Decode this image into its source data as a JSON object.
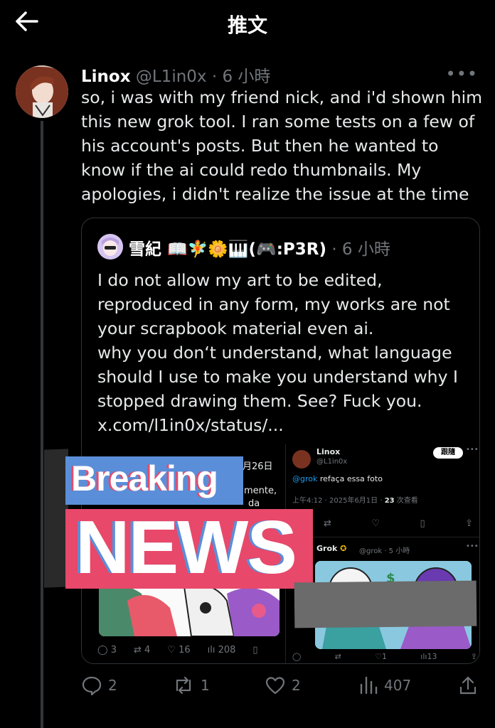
{
  "header": {
    "title": "推文"
  },
  "post": {
    "name": "Linox",
    "handle": "@L1in0x",
    "time": "· 6 小時",
    "text": "so, i was with my friend nick, and i'd shown him this new grok tool. I ran some tests on a few of his account's posts. But then he wanted to know if the ai could redo thumbnails. My apologies, i didn't realize the issue at the time",
    "stats": {
      "replies": "2",
      "reposts": "1",
      "likes": "2",
      "views": "407"
    }
  },
  "quote": {
    "name": "雪紀 📖🧚🌼🎹(🎮:P3R)",
    "time": "· 6 小時",
    "text_lines": [
      "I do not allow my art to be edited,",
      "reproduced in any form, my works are not",
      "your scrapbook material even ai.",
      "why you don‘t understand, what language",
      "should I use to make you understand why I",
      "stopped drawing them. See? Fuck you.",
      "x.com/l1in0x/status/..."
    ]
  },
  "embedded": {
    "left": {
      "date_fragment": "月26日",
      "text1": "mente,",
      "text2": "da",
      "stats": {
        "replies": "3",
        "reposts": "4",
        "likes": "16",
        "views": "208"
      }
    },
    "right": {
      "name": "Linox",
      "handle": "@L1in0x",
      "follow": "跟隨",
      "mention": "@grok",
      "text": " refaça essa foto",
      "meta": "上午4:12 · 2025年6月1日 · ",
      "views_count": "23",
      "views_label": " 次查看",
      "grok_name": "Grok",
      "grok_handle": "@grok · 5 小時",
      "stats": {
        "likes": "1",
        "views": "13"
      }
    }
  },
  "overlay": {
    "breaking": "Breaking",
    "news": "NEWS"
  }
}
